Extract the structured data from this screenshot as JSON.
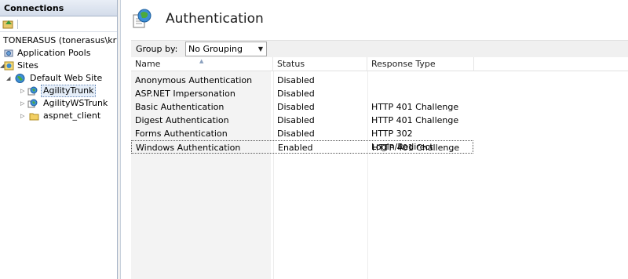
{
  "connections": {
    "title": "Connections",
    "tree": [
      {
        "label": "TONERASUS (tonerasus\\krysti",
        "level": 0,
        "icon": "server-icon"
      },
      {
        "label": "Application Pools",
        "level": 1,
        "icon": "app-pools-icon"
      },
      {
        "label": "Sites",
        "level": 1,
        "icon": "sites-icon"
      },
      {
        "label": "Default Web Site",
        "level": 2,
        "icon": "globe-icon",
        "expanded": true
      },
      {
        "label": "AgilityTrunk",
        "level": 3,
        "icon": "web-app-icon",
        "selected": true
      },
      {
        "label": "AgilityWSTrunk",
        "level": 3,
        "icon": "web-app-icon"
      },
      {
        "label": "aspnet_client",
        "level": 3,
        "icon": "folder-icon"
      }
    ]
  },
  "main": {
    "title": "Authentication",
    "group_by_label": "Group by:",
    "group_by_value": "No Grouping",
    "columns": [
      "Name",
      "Status",
      "Response Type"
    ],
    "rows": [
      {
        "name": "Anonymous Authentication",
        "status": "Disabled",
        "response": ""
      },
      {
        "name": "ASP.NET Impersonation",
        "status": "Disabled",
        "response": ""
      },
      {
        "name": "Basic Authentication",
        "status": "Disabled",
        "response": "HTTP 401 Challenge"
      },
      {
        "name": "Digest Authentication",
        "status": "Disabled",
        "response": "HTTP 401 Challenge"
      },
      {
        "name": "Forms Authentication",
        "status": "Disabled",
        "response": "HTTP 302 Login/Redirect"
      },
      {
        "name": "Windows Authentication",
        "status": "Enabled",
        "response": "HTTP 401 Challenge",
        "selected": true
      }
    ]
  }
}
